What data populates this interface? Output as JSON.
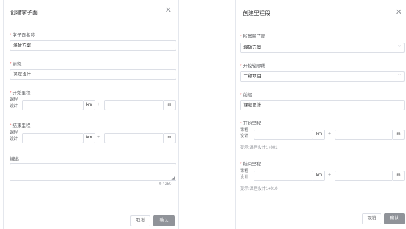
{
  "left_dialog": {
    "title": "创建掌子面",
    "close_icon": "close-icon",
    "name_label": "掌子面名称",
    "name_value": "爆破方案",
    "prefix_label": "前缀",
    "prefix_value": "课程设计",
    "start_label": "开始里程",
    "start_sub": "课程\n设计",
    "end_label": "结束里程",
    "end_sub": "课程\n设计",
    "unit_km": "km",
    "unit_m": "m",
    "plus": "+",
    "desc_label": "描述",
    "desc_counter": "0 / 250",
    "cancel_label": "取消",
    "ok_label": "确认"
  },
  "right_dialog": {
    "title": "创建里程段",
    "close_icon": "close-icon",
    "face_label": "所属掌子面",
    "face_value": "爆破方案",
    "line_label": "开挖轮廓线",
    "line_value": "二级项目",
    "prefix_label": "前缀",
    "prefix_value": "课程设计",
    "start_label": "开始里程",
    "start_sub": "课程\n设计",
    "start_hint": "提示:课程设计1+001",
    "end_label": "结束里程",
    "end_sub": "课程\n设计",
    "end_hint": "提示:课程设计1+010",
    "unit_km": "km",
    "unit_m": "m",
    "plus": "+",
    "cancel_label": "取消",
    "ok_label": "确认"
  },
  "colors": {
    "required": "#f56c6c",
    "border": "#dcdfe6",
    "primary_disabled": "#909399"
  }
}
